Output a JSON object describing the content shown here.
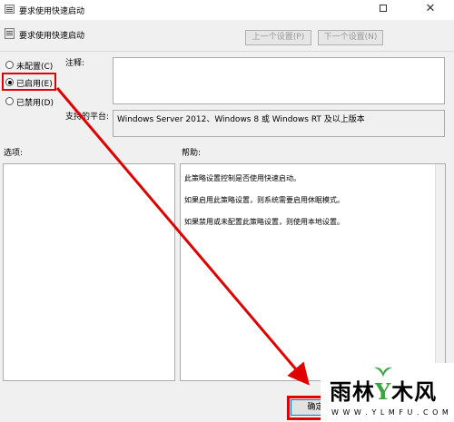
{
  "window": {
    "title": "要求使用快速启动",
    "close_glyph": "✕"
  },
  "header": {
    "title": "要求使用快速启动",
    "prev_label": "上一个设置(P)",
    "next_label": "下一个设置(N)"
  },
  "options": [
    {
      "label": "未配置(C)",
      "checked": false
    },
    {
      "label": "已启用(E)",
      "checked": true
    },
    {
      "label": "已禁用(D)",
      "checked": false
    }
  ],
  "comment": {
    "label": "注释:",
    "value": ""
  },
  "platform": {
    "label": "支持的平台:",
    "value": "Windows Server 2012、Windows 8 或 Windows RT 及以上版本"
  },
  "panes": {
    "options_label": "选项:",
    "help_label": "帮助:"
  },
  "help": [
    "此策略设置控制是否使用快速启动。",
    "如果启用此策略设置，则系统需要启用休眠模式。",
    "如果禁用或未配置此策略设置，则使用本地设置。"
  ],
  "footer": {
    "ok_label": "确定"
  },
  "watermark": {
    "brand_a": "雨林",
    "brand_y": "Y",
    "brand_b": "木风",
    "url": "W W W . Y L M F U . C O M"
  },
  "colors": {
    "annotation_red": "#e00000",
    "accent_blue": "#0078d7",
    "watermark_green": "#3aa540"
  }
}
